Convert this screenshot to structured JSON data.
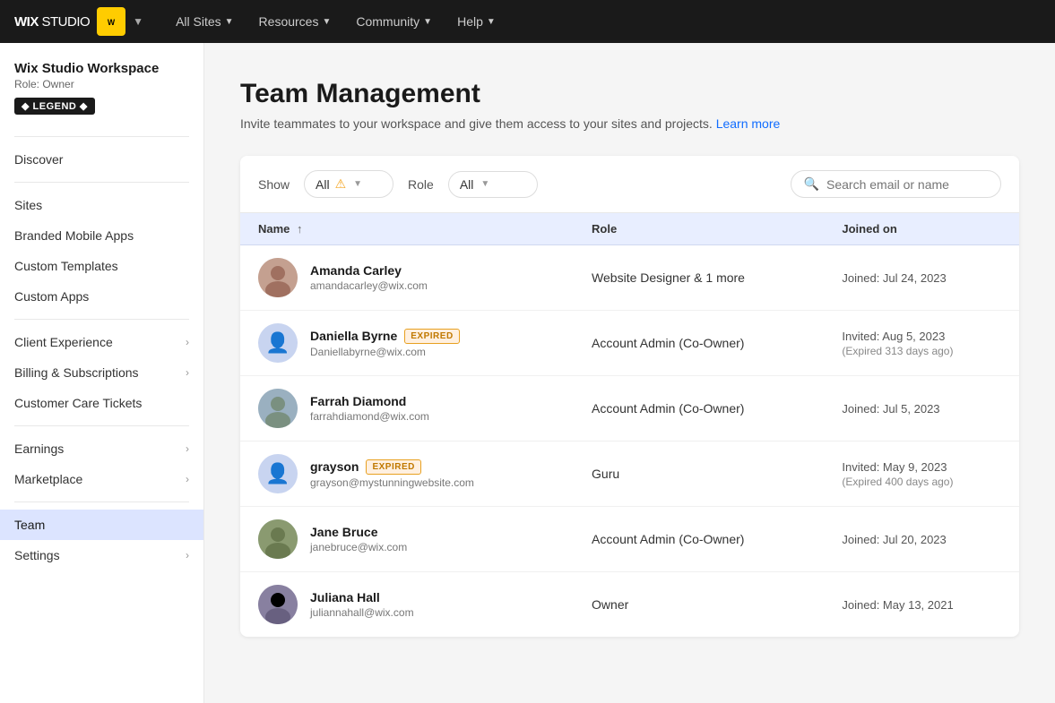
{
  "topNav": {
    "brand": "WIX STUDIO",
    "logoText": "WIX",
    "items": [
      {
        "label": "All Sites",
        "hasChevron": true
      },
      {
        "label": "Resources",
        "hasChevron": true
      },
      {
        "label": "Community",
        "hasChevron": true
      },
      {
        "label": "Help",
        "hasChevron": true
      }
    ]
  },
  "sidebar": {
    "workspaceName": "Wix Studio Workspace",
    "role": "Role: Owner",
    "badge": "◆ LEGEND ◆",
    "discoverLabel": "Discover",
    "items": [
      {
        "label": "Sites",
        "hasChevron": false,
        "active": false
      },
      {
        "label": "Branded Mobile Apps",
        "hasChevron": false,
        "active": false
      },
      {
        "label": "Custom Templates",
        "hasChevron": false,
        "active": false
      },
      {
        "label": "Custom Apps",
        "hasChevron": false,
        "active": false
      },
      {
        "label": "Client Experience",
        "hasChevron": true,
        "active": false
      },
      {
        "label": "Billing & Subscriptions",
        "hasChevron": true,
        "active": false
      },
      {
        "label": "Customer Care Tickets",
        "hasChevron": false,
        "active": false
      },
      {
        "label": "Earnings",
        "hasChevron": true,
        "active": false
      },
      {
        "label": "Marketplace",
        "hasChevron": true,
        "active": false
      },
      {
        "label": "Team",
        "hasChevron": false,
        "active": true
      },
      {
        "label": "Settings",
        "hasChevron": true,
        "active": false
      }
    ]
  },
  "page": {
    "title": "Team Management",
    "subtitle": "Invite teammates to your workspace and give them access to your sites and projects.",
    "learnMoreLabel": "Learn more",
    "learnMoreUrl": "#"
  },
  "filters": {
    "showLabel": "Show",
    "showValue": "All",
    "roleLabel": "Role",
    "roleValue": "All",
    "searchPlaceholder": "Search email or name"
  },
  "table": {
    "columns": [
      {
        "label": "Name",
        "sortable": true
      },
      {
        "label": "Role",
        "sortable": false
      },
      {
        "label": "Joined on",
        "sortable": false
      }
    ],
    "rows": [
      {
        "name": "Amanda Carley",
        "email": "amandacarley@wix.com",
        "role": "Website Designer & 1 more",
        "joinedLine1": "Joined: Jul 24, 2023",
        "joinedLine2": "",
        "expired": false,
        "avatarType": "image",
        "avatarColor": "#d4a0a0"
      },
      {
        "name": "Daniella Byrne",
        "email": "Daniellabyrne@wix.com",
        "role": "Account Admin (Co-Owner)",
        "joinedLine1": "Invited: Aug 5, 2023",
        "joinedLine2": "(Expired 313 days ago)",
        "expired": true,
        "avatarType": "placeholder",
        "avatarColor": "#c8d4f0"
      },
      {
        "name": "Farrah Diamond",
        "email": "farrahdiamond@wix.com",
        "role": "Account Admin (Co-Owner)",
        "joinedLine1": "Joined: Jul 5, 2023",
        "joinedLine2": "",
        "expired": false,
        "avatarType": "image",
        "avatarColor": "#a0b4c0"
      },
      {
        "name": "grayson",
        "email": "grayson@mystunningwebsite.com",
        "role": "Guru",
        "joinedLine1": "Invited: May 9, 2023",
        "joinedLine2": "(Expired 400 days ago)",
        "expired": true,
        "avatarType": "placeholder",
        "avatarColor": "#c8d4f0"
      },
      {
        "name": "Jane Bruce",
        "email": "janebruce@wix.com",
        "role": "Account Admin (Co-Owner)",
        "joinedLine1": "Joined: Jul 20, 2023",
        "joinedLine2": "",
        "expired": false,
        "avatarType": "image",
        "avatarColor": "#8a9a7a"
      },
      {
        "name": "Juliana Hall",
        "email": "juliannahall@wix.com",
        "role": "Owner",
        "joinedLine1": "Joined: May 13, 2021",
        "joinedLine2": "",
        "expired": false,
        "avatarType": "image",
        "avatarColor": "#9090b0"
      }
    ],
    "expiredBadgeLabel": "EXPIRED"
  },
  "avatarColors": {
    "amanda": "#c4a090",
    "farrah": "#9ab0c0",
    "jane": "#7a9a70",
    "juliana": "#8880a0"
  }
}
